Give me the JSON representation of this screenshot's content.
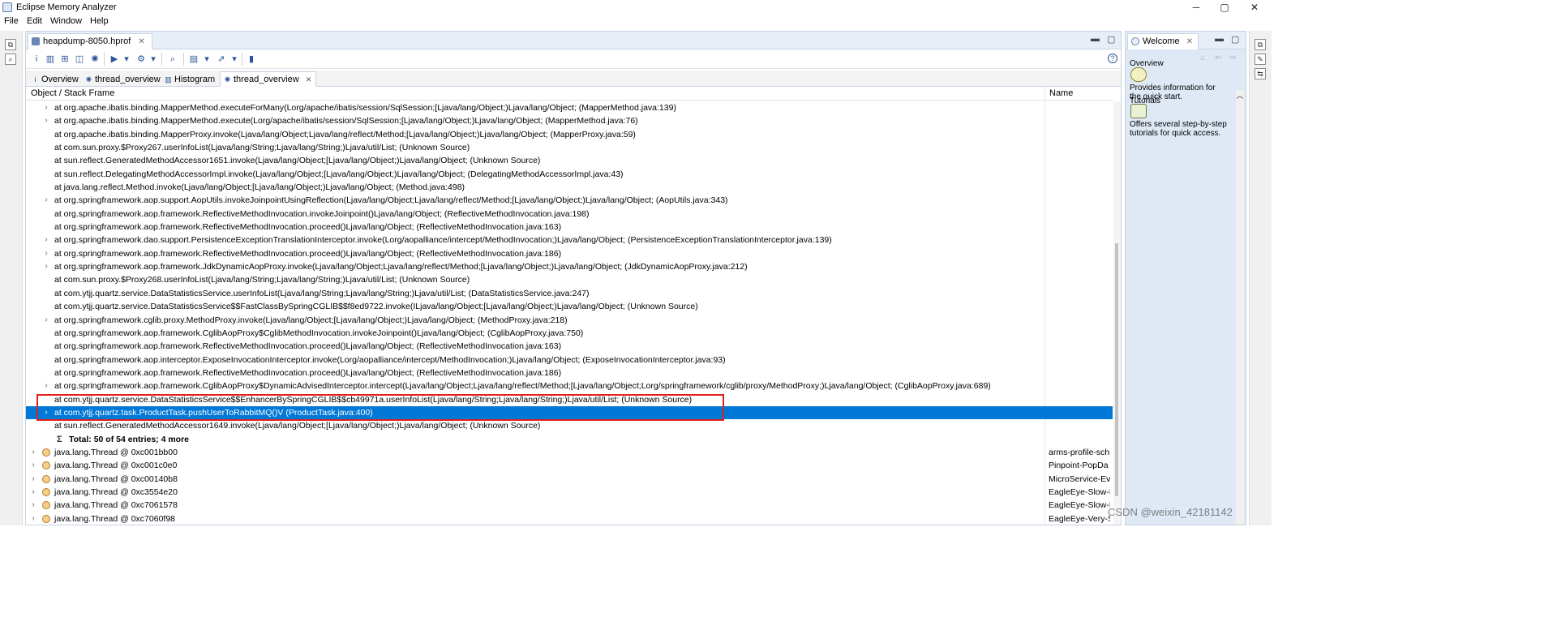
{
  "window": {
    "title": "Eclipse Memory Analyzer",
    "controls": {
      "minimize": "─",
      "maximize": "▢",
      "close": "✕"
    }
  },
  "menu": [
    "File",
    "Edit",
    "Window",
    "Help"
  ],
  "editor": {
    "file_tab": "heapdump-8050.hprof",
    "sub_tabs": [
      {
        "label": "Overview",
        "icon": "info-icon"
      },
      {
        "label": "thread_overview",
        "icon": "thread-icon"
      },
      {
        "label": "Histogram",
        "icon": "histogram-icon"
      },
      {
        "label": "thread_overview",
        "icon": "thread-icon",
        "active": true,
        "closable": true
      }
    ],
    "columns": {
      "frame": "Object / Stack Frame",
      "name": "Name"
    },
    "frames": [
      {
        "text": "at org.apache.ibatis.binding.MapperMethod.executeForMany(Lorg/apache/ibatis/session/SqlSession;[Ljava/lang/Object;)Ljava/lang/Object; (MapperMethod.java:139)",
        "expandable": true
      },
      {
        "text": "at org.apache.ibatis.binding.MapperMethod.execute(Lorg/apache/ibatis/session/SqlSession;[Ljava/lang/Object;)Ljava/lang/Object; (MapperMethod.java:76)",
        "expandable": true
      },
      {
        "text": "at org.apache.ibatis.binding.MapperProxy.invoke(Ljava/lang/Object;Ljava/lang/reflect/Method;[Ljava/lang/Object;)Ljava/lang/Object; (MapperProxy.java:59)",
        "expandable": false
      },
      {
        "text": "at com.sun.proxy.$Proxy267.userInfoList(Ljava/lang/String;Ljava/lang/String;)Ljava/util/List; (Unknown Source)",
        "expandable": false
      },
      {
        "text": "at sun.reflect.GeneratedMethodAccessor1651.invoke(Ljava/lang/Object;[Ljava/lang/Object;)Ljava/lang/Object; (Unknown Source)",
        "expandable": false
      },
      {
        "text": "at sun.reflect.DelegatingMethodAccessorImpl.invoke(Ljava/lang/Object;[Ljava/lang/Object;)Ljava/lang/Object; (DelegatingMethodAccessorImpl.java:43)",
        "expandable": false
      },
      {
        "text": "at java.lang.reflect.Method.invoke(Ljava/lang/Object;[Ljava/lang/Object;)Ljava/lang/Object; (Method.java:498)",
        "expandable": false
      },
      {
        "text": "at org.springframework.aop.support.AopUtils.invokeJoinpointUsingReflection(Ljava/lang/Object;Ljava/lang/reflect/Method;[Ljava/lang/Object;)Ljava/lang/Object; (AopUtils.java:343)",
        "expandable": true
      },
      {
        "text": "at org.springframework.aop.framework.ReflectiveMethodInvocation.invokeJoinpoint()Ljava/lang/Object; (ReflectiveMethodInvocation.java:198)",
        "expandable": false
      },
      {
        "text": "at org.springframework.aop.framework.ReflectiveMethodInvocation.proceed()Ljava/lang/Object; (ReflectiveMethodInvocation.java:163)",
        "expandable": false
      },
      {
        "text": "at org.springframework.dao.support.PersistenceExceptionTranslationInterceptor.invoke(Lorg/aopalliance/intercept/MethodInvocation;)Ljava/lang/Object; (PersistenceExceptionTranslationInterceptor.java:139)",
        "expandable": true
      },
      {
        "text": "at org.springframework.aop.framework.ReflectiveMethodInvocation.proceed()Ljava/lang/Object; (ReflectiveMethodInvocation.java:186)",
        "expandable": true
      },
      {
        "text": "at org.springframework.aop.framework.JdkDynamicAopProxy.invoke(Ljava/lang/Object;Ljava/lang/reflect/Method;[Ljava/lang/Object;)Ljava/lang/Object; (JdkDynamicAopProxy.java:212)",
        "expandable": true
      },
      {
        "text": "at com.sun.proxy.$Proxy268.userInfoList(Ljava/lang/String;Ljava/lang/String;)Ljava/util/List; (Unknown Source)",
        "expandable": false
      },
      {
        "text": "at com.ytjj.quartz.service.DataStatisticsService.userInfoList(Ljava/lang/String;Ljava/lang/String;)Ljava/util/List; (DataStatisticsService.java:247)",
        "expandable": false
      },
      {
        "text": "at com.ytjj.quartz.service.DataStatisticsService$$FastClassBySpringCGLIB$$f8ed9722.invoke(ILjava/lang/Object;[Ljava/lang/Object;)Ljava/lang/Object; (Unknown Source)",
        "expandable": false
      },
      {
        "text": "at org.springframework.cglib.proxy.MethodProxy.invoke(Ljava/lang/Object;[Ljava/lang/Object;)Ljava/lang/Object; (MethodProxy.java:218)",
        "expandable": true
      },
      {
        "text": "at org.springframework.aop.framework.CglibAopProxy$CglibMethodInvocation.invokeJoinpoint()Ljava/lang/Object; (CglibAopProxy.java:750)",
        "expandable": false
      },
      {
        "text": "at org.springframework.aop.framework.ReflectiveMethodInvocation.proceed()Ljava/lang/Object; (ReflectiveMethodInvocation.java:163)",
        "expandable": false
      },
      {
        "text": "at org.springframework.aop.interceptor.ExposeInvocationInterceptor.invoke(Lorg/aopalliance/intercept/MethodInvocation;)Ljava/lang/Object; (ExposeInvocationInterceptor.java:93)",
        "expandable": false
      },
      {
        "text": "at org.springframework.aop.framework.ReflectiveMethodInvocation.proceed()Ljava/lang/Object; (ReflectiveMethodInvocation.java:186)",
        "expandable": false
      },
      {
        "text": "at org.springframework.aop.framework.CglibAopProxy$DynamicAdvisedInterceptor.intercept(Ljava/lang/Object;Ljava/lang/reflect/Method;[Ljava/lang/Object;Lorg/springframework/cglib/proxy/MethodProxy;)Ljava/lang/Object; (CglibAopProxy.java:689)",
        "expandable": true
      },
      {
        "text": "at com.ytjj.quartz.service.DataStatisticsService$$EnhancerBySpringCGLIB$$cb49971a.userInfoList(Ljava/lang/String;Ljava/lang/String;)Ljava/util/List; (Unknown Source)",
        "expandable": false
      },
      {
        "text": "at com.ytjj.quartz.task.ProductTask.pushUserToRabbitMQ()V (ProductTask.java:400)",
        "expandable": true,
        "selected": true
      },
      {
        "text": "at sun.reflect.GeneratedMethodAccessor1649.invoke(Ljava/lang/Object;[Ljava/lang/Object;)Ljava/lang/Object; (Unknown Source)",
        "expandable": false
      }
    ],
    "total_label": "Total: 50 of 54 entries; 4 more",
    "threads": [
      {
        "text": "java.lang.Thread @ 0xc001bb00",
        "name": "arms-profile-sch"
      },
      {
        "text": "java.lang.Thread @ 0xc001c0e0",
        "name": "Pinpoint-PopDa"
      },
      {
        "text": "java.lang.Thread @ 0xc00140b8",
        "name": "MicroService-Ev"
      },
      {
        "text": "java.lang.Thread @ 0xc3554e20",
        "name": "EagleEye-Slow-I"
      },
      {
        "text": "java.lang.Thread @ 0xc7061578",
        "name": "EagleEye-Slow-I"
      },
      {
        "text": "java.lang.Thread @ 0xc7060f98",
        "name": "EagleEye-Very-S"
      }
    ]
  },
  "welcome": {
    "tab": "Welcome",
    "items": [
      {
        "heading": "Overview",
        "icon": "lightbulb-icon",
        "description": "Provides information for the quick start."
      },
      {
        "heading": "Tutorials",
        "icon": "chart-icon",
        "description": "Offers several step-by-step tutorials for quick access."
      }
    ]
  },
  "colors": {
    "selection": "#0078d7",
    "highlight_border": "#e0201b",
    "welcome_bg": "#dfe9f5"
  },
  "watermark": "CSDN @weixin_42181142"
}
